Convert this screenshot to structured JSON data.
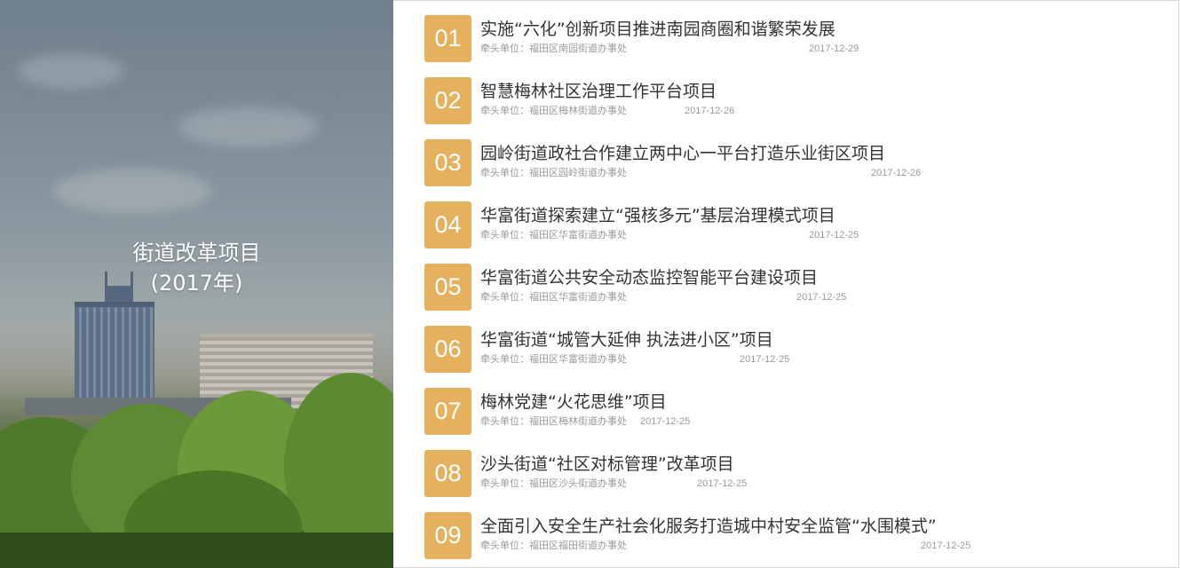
{
  "banner": {
    "title_line1": "街道改革项目",
    "title_line2": "(2017年)"
  },
  "items": [
    {
      "number": "01",
      "title": "实施“六化”创新项目推进南园商圈和谐繁荣发展",
      "lead_label": "牵头单位：福田区南园街道办事处",
      "date": "2017-12-29"
    },
    {
      "number": "02",
      "title": "智慧梅林社区治理工作平台项目",
      "lead_label": "牵头单位：福田区梅林街道办事处",
      "date": "2017-12-26"
    },
    {
      "number": "03",
      "title": "园岭街道政社合作建立两中心一平台打造乐业街区项目",
      "lead_label": "牵头单位：福田区园岭街道办事处",
      "date": "2017-12-26"
    },
    {
      "number": "04",
      "title": "华富街道探索建立“强核多元”基层治理模式项目",
      "lead_label": "牵头单位：福田区华富街道办事处",
      "date": "2017-12-25"
    },
    {
      "number": "05",
      "title": "华富街道公共安全动态监控智能平台建设项目",
      "lead_label": "牵头单位：福田区华富街道办事处",
      "date": "2017-12-25"
    },
    {
      "number": "06",
      "title": "华富街道“城管大延伸 执法进小区”项目",
      "lead_label": "牵头单位：福田区华富街道办事处",
      "date": "2017-12-25"
    },
    {
      "number": "07",
      "title": "梅林党建“火花思维”项目",
      "lead_label": "牵头单位：福田区梅林街道办事处",
      "date": "2017-12-25"
    },
    {
      "number": "08",
      "title": "沙头街道“社区对标管理”改革项目",
      "lead_label": "牵头单位：福田区沙头街道办事处",
      "date": "2017-12-25"
    },
    {
      "number": "09",
      "title": "全面引入安全生产社会化服务打造城中村安全监管“水围模式”",
      "lead_label": "牵头单位：福田区福田街道办事处",
      "date": "2017-12-25"
    }
  ],
  "colors": {
    "number_badge": "#e6b15e",
    "title_text": "#333333",
    "meta_text": "#9a9a9a"
  }
}
